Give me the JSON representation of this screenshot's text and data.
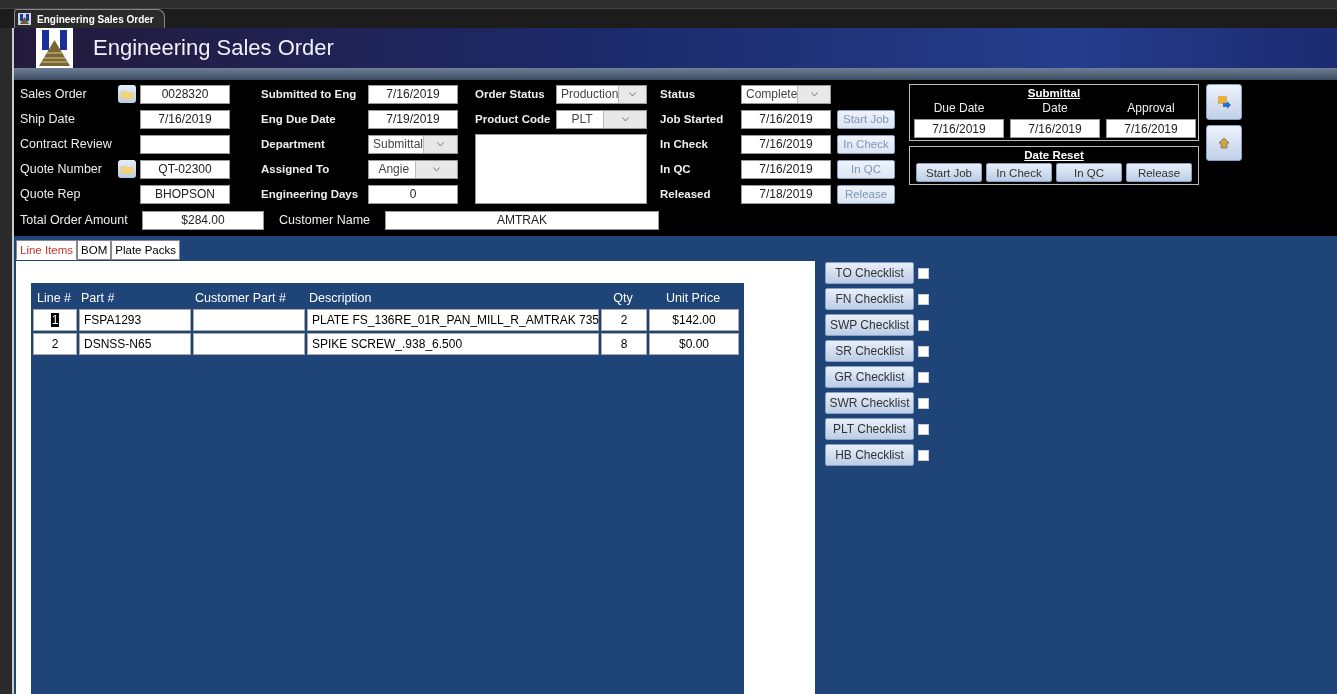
{
  "document_tab": {
    "title": "Engineering Sales Order"
  },
  "header": {
    "title": "Engineering Sales Order"
  },
  "column_1": [
    {
      "label": "Sales Order",
      "value": "0028320",
      "kind": "lookup"
    },
    {
      "label": "Ship Date",
      "value": "7/16/2019",
      "kind": "text"
    },
    {
      "label": "Contract Review",
      "kind": "text"
    },
    {
      "label": "Quote Number",
      "value": "QT-02300",
      "kind": "lookup"
    },
    {
      "label": "Quote Rep",
      "value": "BHOPSON",
      "kind": "text"
    }
  ],
  "column_2": [
    {
      "label": "Submitted to Eng",
      "value": "7/16/2019",
      "kind": "text"
    },
    {
      "label": "Eng Due Date",
      "value": "7/19/2019",
      "kind": "text"
    },
    {
      "label": "Department",
      "value": "Submittal",
      "kind": "combo"
    },
    {
      "label": "Assigned To",
      "value": "Angie",
      "kind": "combo"
    },
    {
      "label": "Engineering Days",
      "value": "0",
      "kind": "text"
    }
  ],
  "column_3": [
    {
      "label": "Order Status",
      "value": "Production",
      "kind": "combo"
    },
    {
      "label": "Product Code",
      "value": "PLT",
      "kind": "combo"
    }
  ],
  "column_4": [
    {
      "label": "Status",
      "value": "Complete",
      "kind": "combo"
    },
    {
      "label": "Job Started",
      "value": "7/16/2019",
      "kind": "date_button",
      "button": "Start Job",
      "disabled": true
    },
    {
      "label": "In Check",
      "value": "7/16/2019",
      "kind": "date_button",
      "button": "In Check",
      "disabled": true
    },
    {
      "label": "In QC",
      "value": "7/16/2019",
      "kind": "date_button",
      "button": "In QC",
      "disabled": true
    },
    {
      "label": "Released",
      "value": "7/18/2019",
      "kind": "date_button",
      "button": "Release",
      "disabled": true
    }
  ],
  "submittal": {
    "title": "Submittal",
    "columns": [
      {
        "label": "Due Date",
        "value": "7/16/2019"
      },
      {
        "label": "Date",
        "value": "7/16/2019"
      },
      {
        "label": "Approval",
        "value": "7/16/2019"
      }
    ]
  },
  "date_reset": {
    "title": "Date Reset",
    "buttons": [
      "Start Job",
      "In Check",
      "In QC",
      "Release"
    ]
  },
  "total_order_amount": {
    "label": "Total Order Amount",
    "value": "$284.00"
  },
  "customer_name": {
    "label": "Customer Name",
    "value": "AMTRAK"
  },
  "subtabs": [
    {
      "label": "Line Items",
      "selected": true
    },
    {
      "label": "BOM",
      "selected": false
    },
    {
      "label": "Plate Packs",
      "selected": false
    }
  ],
  "table": {
    "columns": [
      "Line #",
      "Part #",
      "Customer Part #",
      "Description",
      "Qty",
      "Unit Price"
    ],
    "rows": [
      {
        "focused": true,
        "cells": [
          "1",
          "FSPA1293",
          "",
          "PLATE FS_136RE_01R_PAN_MILL_R_AMTRAK 735",
          "2",
          "$142.00"
        ]
      },
      {
        "focused": false,
        "cells": [
          "2",
          "DSNSS-N65",
          "",
          "SPIKE SCREW_.938_6.500",
          "8",
          "$0.00"
        ]
      }
    ]
  },
  "checklists": [
    {
      "label": "TO Checklist",
      "checked": false
    },
    {
      "label": "FN Checklist",
      "checked": false
    },
    {
      "label": "SWP Checklist",
      "checked": false
    },
    {
      "label": "SR Checklist",
      "checked": false
    },
    {
      "label": "GR Checklist",
      "checked": false
    },
    {
      "label": "SWR Checklist",
      "checked": false
    },
    {
      "label": "PLT Checklist",
      "checked": false
    },
    {
      "label": "HB Checklist",
      "checked": false
    }
  ]
}
